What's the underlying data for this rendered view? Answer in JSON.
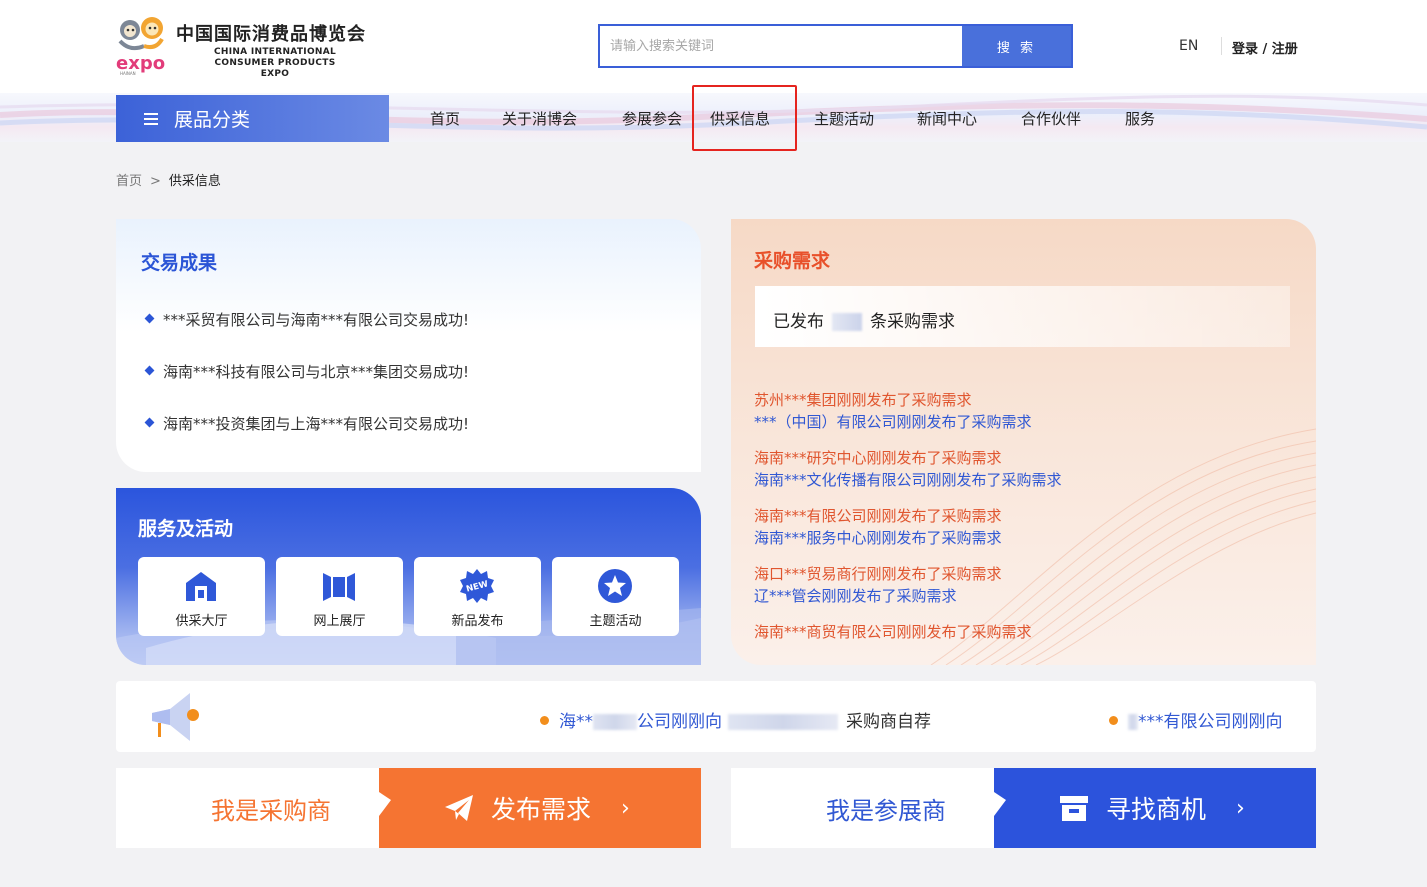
{
  "header": {
    "logo_cn": "中国国际消费品博览会",
    "logo_en_line1": "CHINA INTERNATIONAL",
    "logo_en_line2": "CONSUMER PRODUCTS EXPO",
    "logo_word": "expo",
    "logo_sub": "HAINAN",
    "search_placeholder": "请输入搜索关键词",
    "search_button": "搜 索",
    "lang": "EN",
    "login": "登录 / 注册"
  },
  "nav": {
    "category_button": "展品分类",
    "items": [
      "首页",
      "关于消博会",
      "参展参会",
      "供采信息",
      "主题活动",
      "新闻中心",
      "合作伙伴",
      "服务"
    ],
    "highlighted": "供采信息"
  },
  "breadcrumb": {
    "home": "首页",
    "separator": ">",
    "current": "供采信息"
  },
  "deals": {
    "title": "交易成果",
    "items": [
      "***采贸有限公司与海南***有限公司交易成功!",
      "海南***科技有限公司与北京***集团交易成功!",
      "海南***投资集团与上海***有限公司交易成功!"
    ]
  },
  "service": {
    "title": "服务及活动",
    "tiles": [
      {
        "label": "供采大厅",
        "icon": "hall-icon"
      },
      {
        "label": "网上展厅",
        "icon": "online-gallery-icon"
      },
      {
        "label": "新品发布",
        "icon": "new-badge-icon",
        "badge_text": "NEW"
      },
      {
        "label": "主题活动",
        "icon": "star-icon"
      }
    ]
  },
  "demand": {
    "title": "采购需求",
    "published_prefix": "已发布",
    "published_suffix": "条采购需求",
    "requests": [
      {
        "text": "苏州***集团刚刚发布了采购需求",
        "color": "orange"
      },
      {
        "text": "***（中国）有限公司刚刚发布了采购需求",
        "color": "blue"
      },
      {
        "text": "海南***研究中心刚刚发布了采购需求",
        "color": "orange"
      },
      {
        "text": "海南***文化传播有限公司刚刚发布了采购需求",
        "color": "blue"
      },
      {
        "text": "海南***有限公司刚刚发布了采购需求",
        "color": "orange"
      },
      {
        "text": "海南***服务中心刚刚发布了采购需求",
        "color": "blue"
      },
      {
        "text": "海口***贸易商行刚刚发布了采购需求",
        "color": "orange"
      },
      {
        "text": "辽***管会刚刚发布了采购需求",
        "color": "blue"
      },
      {
        "text": "海南***商贸有限公司刚刚发布了采购需求",
        "color": "orange"
      }
    ]
  },
  "ticker": {
    "item1_a": "海**",
    "item1_b": "公司刚刚向",
    "item1_c": "采购商自荐",
    "item2": "***有限公司刚刚向"
  },
  "cta": {
    "buyer_label": "我是采购商",
    "buyer_action": "发布需求",
    "exhibitor_label": "我是参展商",
    "exhibitor_action": "寻找商机",
    "chevron": "›"
  },
  "colors": {
    "primary_blue": "#2c53dc",
    "orange": "#f57432",
    "highlight_red": "#e5241f"
  }
}
